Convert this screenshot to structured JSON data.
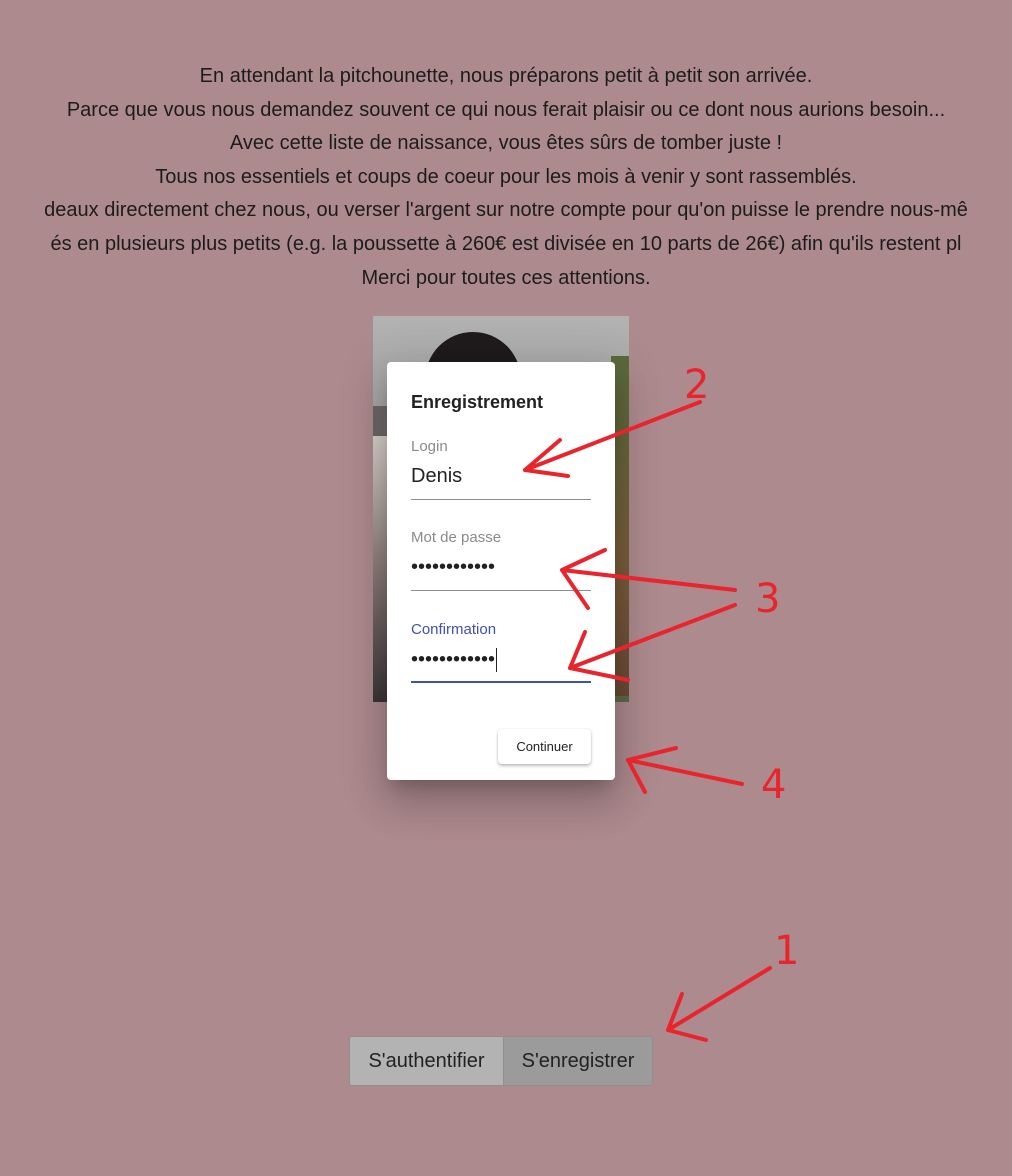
{
  "intro": {
    "lines": [
      "En attendant la pitchounette, nous préparons petit à petit son arrivée.",
      "Parce que vous nous demandez souvent ce qui nous ferait plaisir ou ce dont nous aurions besoin...",
      "Avec cette liste de naissance, vous êtes sûrs de tomber juste !",
      "Tous nos essentiels et coups de coeur pour les mois à venir y sont rassemblés.",
      "deaux directement chez nous, ou verser l'argent sur notre compte pour qu'on puisse le prendre nous-mê",
      "és en plusieurs plus petits (e.g. la poussette à 260€ est divisée en 10 parts de 26€) afin qu'ils restent pl",
      "Merci pour toutes ces attentions."
    ]
  },
  "dialog": {
    "title": "Enregistrement",
    "login_label": "Login",
    "login_value": "Denis",
    "password_label": "Mot de passe",
    "password_value": "••••••••••••",
    "confirm_label": "Confirmation",
    "confirm_value": "••••••••••••",
    "continue_label": "Continuer"
  },
  "auth_toggle": {
    "login_label": "S'authentifier",
    "register_label": "S'enregistrer",
    "selected": "S'enregistrer"
  },
  "annotations": {
    "labels": [
      "1",
      "2",
      "3",
      "4"
    ],
    "color": "#e8242c"
  },
  "colors": {
    "background": "#ad8a8e",
    "accent": "#3f51b5"
  }
}
